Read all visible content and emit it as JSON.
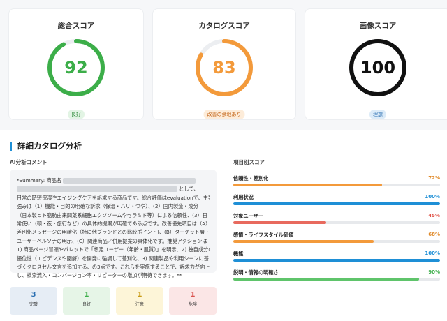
{
  "score_cards": [
    {
      "title": "総合スコア",
      "value": "92",
      "score": 92,
      "color": "#3cae49",
      "badge": "良好",
      "badge_bg": "#e2f4e4",
      "badge_fg": "#2e8a3a"
    },
    {
      "title": "カタログスコア",
      "value": "83",
      "score": 83,
      "color": "#f39a3b",
      "badge": "改善の余地あり",
      "badge_bg": "#fdecd9",
      "badge_fg": "#c4671b"
    },
    {
      "title": "画像スコア",
      "value": "100",
      "score": 100,
      "color": "#111111",
      "badge": "理想",
      "badge_bg": "#dcebf8",
      "badge_fg": "#2a6eb1"
    }
  ],
  "section": {
    "title": "詳細カタログ分析",
    "comment_label": "AI分析コメント",
    "scores_label": "項目別スコア"
  },
  "comment": {
    "line_1": "*Summary: 商品名",
    "line_2_tail": "として、",
    "lines": [
      "日常の時短保湿やエイジングケアを訴求する商品です。総合評価はevaluationで、主要",
      "強みは（1）機能・目的の明確な訴求（保湿・ハリ・つや）、(2）国内製造・成分",
      "（日本製ヒト脂肪由来間葉系細胞エクソソームやセラミド等）による信頼性、(3）日",
      "常使い（朝・夜・旅行など）の具体的提案が明確である点です。改善優先項目は（A）",
      "差別化メッセージの明確化（特に他ブランドとの比較ポイント)、(B）ターゲット層・",
      "ユーザーペルソナの明示、(C）関連商品／併用提案の具体化です。推奨アクションは",
      "1) 商品ページ冒頭やパレットで「想定ユーザー（年齢・肌質）」を明示、2) 独自成分の",
      "優位性（エビデンスや図解）を開発に強調して差別化、3) 関連製品や利用シーンに基",
      "づくクロスセル文言を追加する、の3点です。これらを実施することで、訴求力が向上",
      "し、検索流入・コンバージョン率・リピーターの増加が期待できます。**"
    ]
  },
  "stats": [
    {
      "num": "3",
      "label": "完璧",
      "bg": "#e6edf5",
      "fg": "#2a6eb1"
    },
    {
      "num": "1",
      "label": "良好",
      "bg": "#e6f5e7",
      "fg": "#3cae49"
    },
    {
      "num": "1",
      "label": "注意",
      "bg": "#fdf5d8",
      "fg": "#c99a14"
    },
    {
      "num": "1",
      "label": "危険",
      "bg": "#fbe6e6",
      "fg": "#d9534f"
    }
  ],
  "metrics": [
    {
      "label": "信頼性・差別化",
      "pct": "72%",
      "value": 72,
      "color": "#f39a3b",
      "pct_color": "#e08a2a"
    },
    {
      "label": "利用状況",
      "pct": "100%",
      "value": 100,
      "color": "#1e8fd6",
      "pct_color": "#1e8fd6"
    },
    {
      "label": "対象ユーザー",
      "pct": "45%",
      "value": 45,
      "color": "#e86a5e",
      "pct_color": "#e0554a"
    },
    {
      "label": "感情・ライフスタイル価値",
      "pct": "68%",
      "value": 68,
      "color": "#f39a3b",
      "pct_color": "#e08a2a"
    },
    {
      "label": "機能",
      "pct": "100%",
      "value": 100,
      "color": "#1e8fd6",
      "pct_color": "#1e8fd6"
    },
    {
      "label": "説明・情報の明確さ",
      "pct": "90%",
      "value": 90,
      "color": "#5fc46b",
      "pct_color": "#3cae49"
    }
  ]
}
